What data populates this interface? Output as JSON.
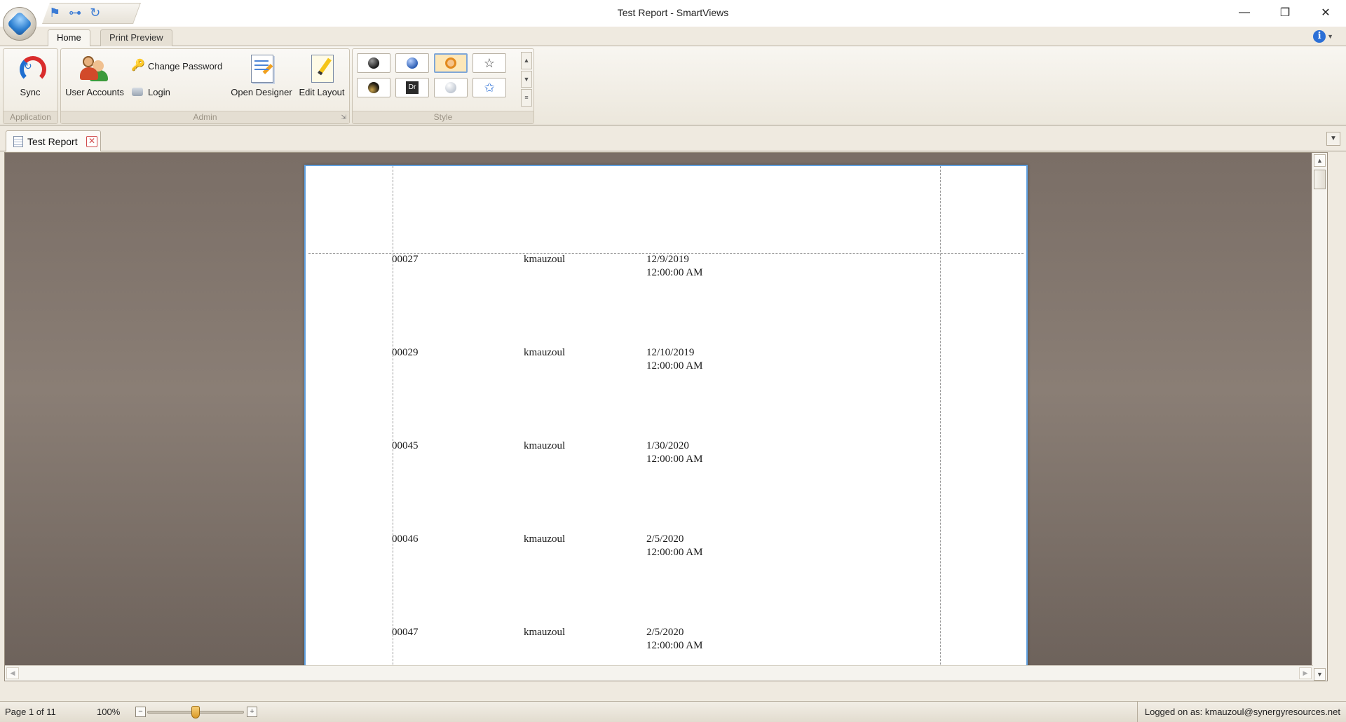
{
  "window": {
    "title": "Test Report - SmartViews",
    "minimize": "—",
    "restore": "❐",
    "close": "✕"
  },
  "quick_access": [
    "flag-icon",
    "tree-icon",
    "redo-icon"
  ],
  "ribbon_tabs": [
    {
      "label": "Home",
      "active": true
    },
    {
      "label": "Print Preview",
      "active": false
    }
  ],
  "info_icon": "i",
  "ribbon": {
    "application": {
      "label": "Application",
      "sync": "Sync"
    },
    "admin": {
      "label": "Admin",
      "user_accounts": "User Accounts",
      "change_password": "Change Password",
      "login": "Login",
      "open_designer": "Open Designer",
      "edit_layout": "Edit Layout"
    },
    "style": {
      "label": "Style",
      "selected_index": 2,
      "swatches": [
        {
          "name": "dark-sphere",
          "color": "#2b2b2b"
        },
        {
          "name": "blue-sphere",
          "color": "#3a6fc4"
        },
        {
          "name": "orange-ring",
          "color": "#e28a1e"
        },
        {
          "name": "outline-star",
          "color": "#555555"
        },
        {
          "name": "dark-gold-sphere",
          "color": "#3a3426"
        },
        {
          "name": "dr-box",
          "text": "Dr",
          "color": "#2a2a2a"
        },
        {
          "name": "light-sphere",
          "color": "#d8dde4"
        },
        {
          "name": "blue-star",
          "color": "#2b6fd6"
        }
      ]
    }
  },
  "document_tab": {
    "label": "Test Report"
  },
  "report_rows": [
    {
      "id": "00027",
      "user": "kmauzoul",
      "date": "12/9/2019",
      "time": "12:00:00 AM"
    },
    {
      "id": "00029",
      "user": "kmauzoul",
      "date": "12/10/2019",
      "time": "12:00:00 AM"
    },
    {
      "id": "00045",
      "user": "kmauzoul",
      "date": "1/30/2020",
      "time": "12:00:00 AM"
    },
    {
      "id": "00046",
      "user": "kmauzoul",
      "date": "2/5/2020",
      "time": "12:00:00 AM"
    },
    {
      "id": "00047",
      "user": "kmauzoul",
      "date": "2/5/2020",
      "time": "12:00:00 AM"
    }
  ],
  "status": {
    "page": "Page 1 of 11",
    "zoom": "100%",
    "zoom_minus": "−",
    "zoom_plus": "+",
    "zoom_fraction": 0.5,
    "logged_on": "Logged on as: kmauzoul@synergyresources.net"
  }
}
